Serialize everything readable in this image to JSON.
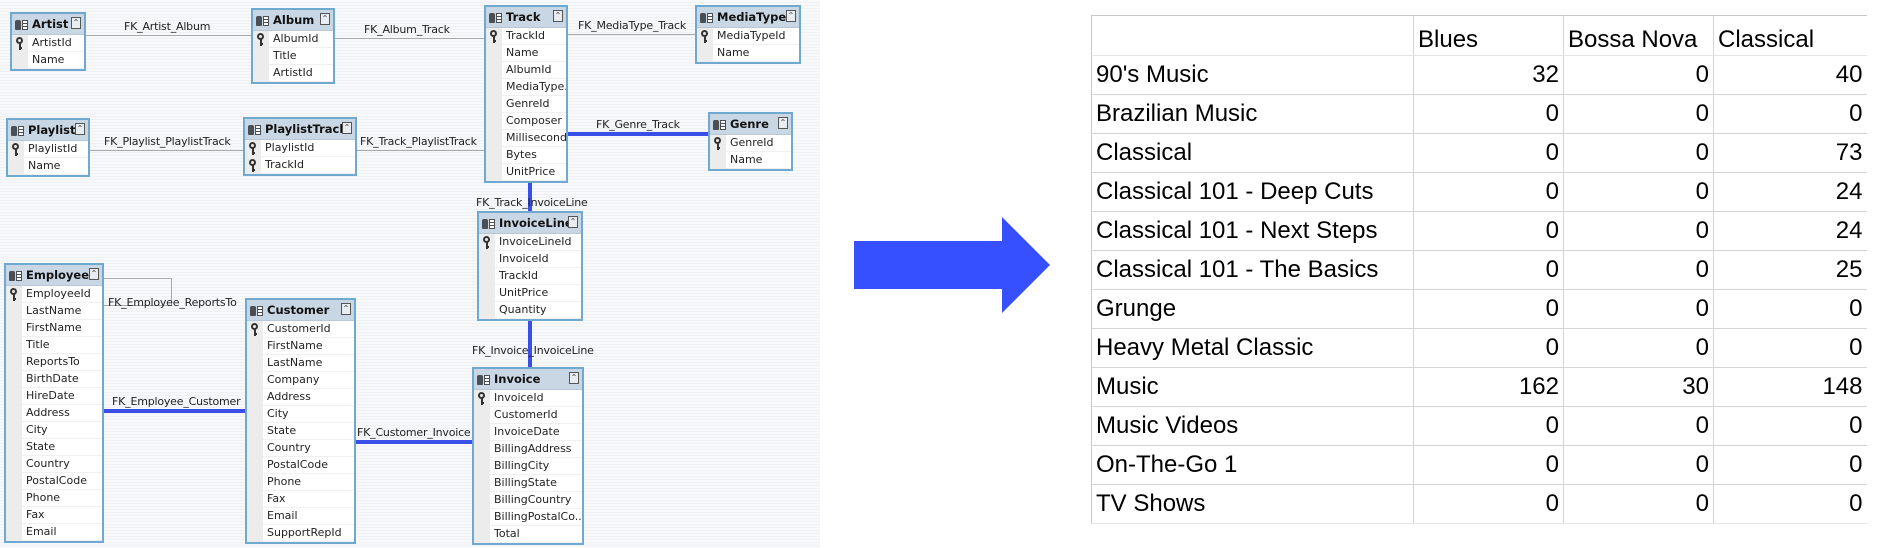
{
  "diagram": {
    "tables": [
      {
        "id": "artist",
        "name": "Artist",
        "columns": [
          {
            "name": "ArtistId",
            "key": true
          },
          {
            "name": "Name",
            "key": false
          }
        ]
      },
      {
        "id": "album",
        "name": "Album",
        "columns": [
          {
            "name": "AlbumId",
            "key": true
          },
          {
            "name": "Title",
            "key": false
          },
          {
            "name": "ArtistId",
            "key": false
          }
        ]
      },
      {
        "id": "track",
        "name": "Track",
        "columns": [
          {
            "name": "TrackId",
            "key": true
          },
          {
            "name": "Name",
            "key": false
          },
          {
            "name": "AlbumId",
            "key": false
          },
          {
            "name": "MediaType...",
            "key": false
          },
          {
            "name": "GenreId",
            "key": false
          },
          {
            "name": "Composer",
            "key": false
          },
          {
            "name": "Milliseconds",
            "key": false
          },
          {
            "name": "Bytes",
            "key": false
          },
          {
            "name": "UnitPrice",
            "key": false
          }
        ]
      },
      {
        "id": "mediatype",
        "name": "MediaType",
        "columns": [
          {
            "name": "MediaTypeId",
            "key": true
          },
          {
            "name": "Name",
            "key": false
          }
        ]
      },
      {
        "id": "playlist",
        "name": "Playlist",
        "columns": [
          {
            "name": "PlaylistId",
            "key": true
          },
          {
            "name": "Name",
            "key": false
          }
        ]
      },
      {
        "id": "playlisttrack",
        "name": "PlaylistTrack",
        "columns": [
          {
            "name": "PlaylistId",
            "key": true
          },
          {
            "name": "TrackId",
            "key": true
          }
        ]
      },
      {
        "id": "genre",
        "name": "Genre",
        "columns": [
          {
            "name": "GenreId",
            "key": true
          },
          {
            "name": "Name",
            "key": false
          }
        ]
      },
      {
        "id": "invoiceline",
        "name": "InvoiceLine",
        "columns": [
          {
            "name": "InvoiceLineId",
            "key": true
          },
          {
            "name": "InvoiceId",
            "key": false
          },
          {
            "name": "TrackId",
            "key": false
          },
          {
            "name": "UnitPrice",
            "key": false
          },
          {
            "name": "Quantity",
            "key": false
          }
        ]
      },
      {
        "id": "employee",
        "name": "Employee",
        "columns": [
          {
            "name": "EmployeeId",
            "key": true
          },
          {
            "name": "LastName",
            "key": false
          },
          {
            "name": "FirstName",
            "key": false
          },
          {
            "name": "Title",
            "key": false
          },
          {
            "name": "ReportsTo",
            "key": false
          },
          {
            "name": "BirthDate",
            "key": false
          },
          {
            "name": "HireDate",
            "key": false
          },
          {
            "name": "Address",
            "key": false
          },
          {
            "name": "City",
            "key": false
          },
          {
            "name": "State",
            "key": false
          },
          {
            "name": "Country",
            "key": false
          },
          {
            "name": "PostalCode",
            "key": false
          },
          {
            "name": "Phone",
            "key": false
          },
          {
            "name": "Fax",
            "key": false
          },
          {
            "name": "Email",
            "key": false
          }
        ]
      },
      {
        "id": "customer",
        "name": "Customer",
        "columns": [
          {
            "name": "CustomerId",
            "key": true
          },
          {
            "name": "FirstName",
            "key": false
          },
          {
            "name": "LastName",
            "key": false
          },
          {
            "name": "Company",
            "key": false
          },
          {
            "name": "Address",
            "key": false
          },
          {
            "name": "City",
            "key": false
          },
          {
            "name": "State",
            "key": false
          },
          {
            "name": "Country",
            "key": false
          },
          {
            "name": "PostalCode",
            "key": false
          },
          {
            "name": "Phone",
            "key": false
          },
          {
            "name": "Fax",
            "key": false
          },
          {
            "name": "Email",
            "key": false
          },
          {
            "name": "SupportRepId",
            "key": false
          }
        ]
      },
      {
        "id": "invoice",
        "name": "Invoice",
        "columns": [
          {
            "name": "InvoiceId",
            "key": true
          },
          {
            "name": "CustomerId",
            "key": false
          },
          {
            "name": "InvoiceDate",
            "key": false
          },
          {
            "name": "BillingAddress",
            "key": false
          },
          {
            "name": "BillingCity",
            "key": false
          },
          {
            "name": "BillingState",
            "key": false
          },
          {
            "name": "BillingCountry",
            "key": false
          },
          {
            "name": "BillingPostalCo...",
            "key": false
          },
          {
            "name": "Total",
            "key": false
          }
        ]
      }
    ],
    "relationships": [
      {
        "id": "artist-album",
        "name": "FK_Artist_Album",
        "from": "Artist",
        "to": "Album",
        "highlighted": false
      },
      {
        "id": "album-track",
        "name": "FK_Album_Track",
        "from": "Album",
        "to": "Track",
        "highlighted": false
      },
      {
        "id": "mediatype-track",
        "name": "FK_MediaType_Track",
        "from": "MediaType",
        "to": "Track",
        "highlighted": false
      },
      {
        "id": "playlist-playlisttrack",
        "name": "FK_Playlist_PlaylistTrack",
        "from": "Playlist",
        "to": "PlaylistTrack",
        "highlighted": false
      },
      {
        "id": "track-playlisttrack",
        "name": "FK_Track_PlaylistTrack",
        "from": "Track",
        "to": "PlaylistTrack",
        "highlighted": false
      },
      {
        "id": "genre-track",
        "name": "FK_Genre_Track",
        "from": "Genre",
        "to": "Track",
        "highlighted": true
      },
      {
        "id": "track-invoiceline",
        "name": "FK_Track_InvoiceLine",
        "from": "Track",
        "to": "InvoiceLine",
        "highlighted": true
      },
      {
        "id": "invoice-invoiceline",
        "name": "FK_Invoice_InvoiceLine",
        "from": "Invoice",
        "to": "InvoiceLine",
        "highlighted": true
      },
      {
        "id": "employee-reportsto",
        "name": "FK_Employee_ReportsTo",
        "from": "Employee",
        "to": "Employee",
        "highlighted": false
      },
      {
        "id": "employee-customer",
        "name": "FK_Employee_Customer",
        "from": "Employee",
        "to": "Customer",
        "highlighted": true
      },
      {
        "id": "customer-invoice",
        "name": "FK_Customer_Invoice",
        "from": "Customer",
        "to": "Invoice",
        "highlighted": true
      }
    ],
    "collapse_glyph": "⌃",
    "colors": {
      "highlight_line": "#3a4fe8",
      "normal_line": "#a9a9a9",
      "table_border": "#6fa9cf",
      "table_header": "#c9d6e4"
    }
  },
  "arrow": {
    "icon": "right-arrow-icon",
    "color": "#3650ff"
  },
  "result": {
    "headers": [
      "",
      "Blues",
      "Bossa Nova",
      "Classical"
    ],
    "rows": [
      {
        "label": "90's Music",
        "values": [
          32,
          0,
          40
        ]
      },
      {
        "label": "Brazilian Music",
        "values": [
          0,
          0,
          0
        ]
      },
      {
        "label": "Classical",
        "values": [
          0,
          0,
          73
        ]
      },
      {
        "label": "Classical 101 - Deep Cuts",
        "values": [
          0,
          0,
          24
        ]
      },
      {
        "label": "Classical 101 - Next Steps",
        "values": [
          0,
          0,
          24
        ]
      },
      {
        "label": "Classical 101 - The Basics",
        "values": [
          0,
          0,
          25
        ]
      },
      {
        "label": "Grunge",
        "values": [
          0,
          0,
          0
        ]
      },
      {
        "label": "Heavy Metal Classic",
        "values": [
          0,
          0,
          0
        ]
      },
      {
        "label": "Music",
        "values": [
          162,
          30,
          148
        ]
      },
      {
        "label": "Music Videos",
        "values": [
          0,
          0,
          0
        ]
      },
      {
        "label": "On-The-Go 1",
        "values": [
          0,
          0,
          0
        ]
      },
      {
        "label": "TV Shows",
        "values": [
          0,
          0,
          0
        ]
      }
    ]
  }
}
